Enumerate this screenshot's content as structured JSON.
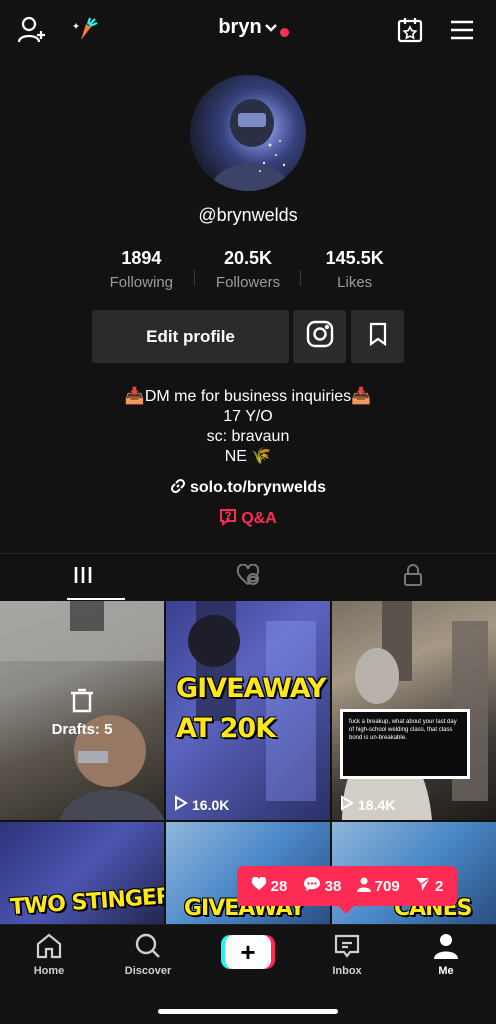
{
  "header": {
    "username": "bryn"
  },
  "profile": {
    "handle": "@brynwelds",
    "stats": [
      {
        "value": "1894",
        "label": "Following"
      },
      {
        "value": "20.5K",
        "label": "Followers"
      },
      {
        "value": "145.5K",
        "label": "Likes"
      }
    ],
    "edit_label": "Edit profile",
    "bio": [
      "📥DM me for business inquiries📥",
      "17 Y/O",
      "sc: bravaun",
      "NE 🌾"
    ],
    "link": "solo.to/brynwelds",
    "qa_label": "Q&A"
  },
  "videos": [
    {
      "drafts_label": "Drafts: 5"
    },
    {
      "caption": "GIVEAWAY AT 20K",
      "views": "16.0K"
    },
    {
      "caption": "fuck a breakup, what about your last day of high-school welding class, that class bond is un-breakable.",
      "views": "18.4K"
    },
    {
      "caption": "TWO STINGER"
    },
    {
      "caption": "GIVEAWAY"
    },
    {
      "caption": "CANES"
    }
  ],
  "notifications": {
    "likes": "28",
    "comments": "38",
    "followers": "709",
    "mentions": "2"
  },
  "nav": {
    "home": "Home",
    "discover": "Discover",
    "inbox": "Inbox",
    "me": "Me"
  },
  "colors": {
    "accent": "#fe2c55",
    "cyan": "#25f4ee",
    "background": "#121212",
    "caption_yellow": "#ffe81a"
  }
}
